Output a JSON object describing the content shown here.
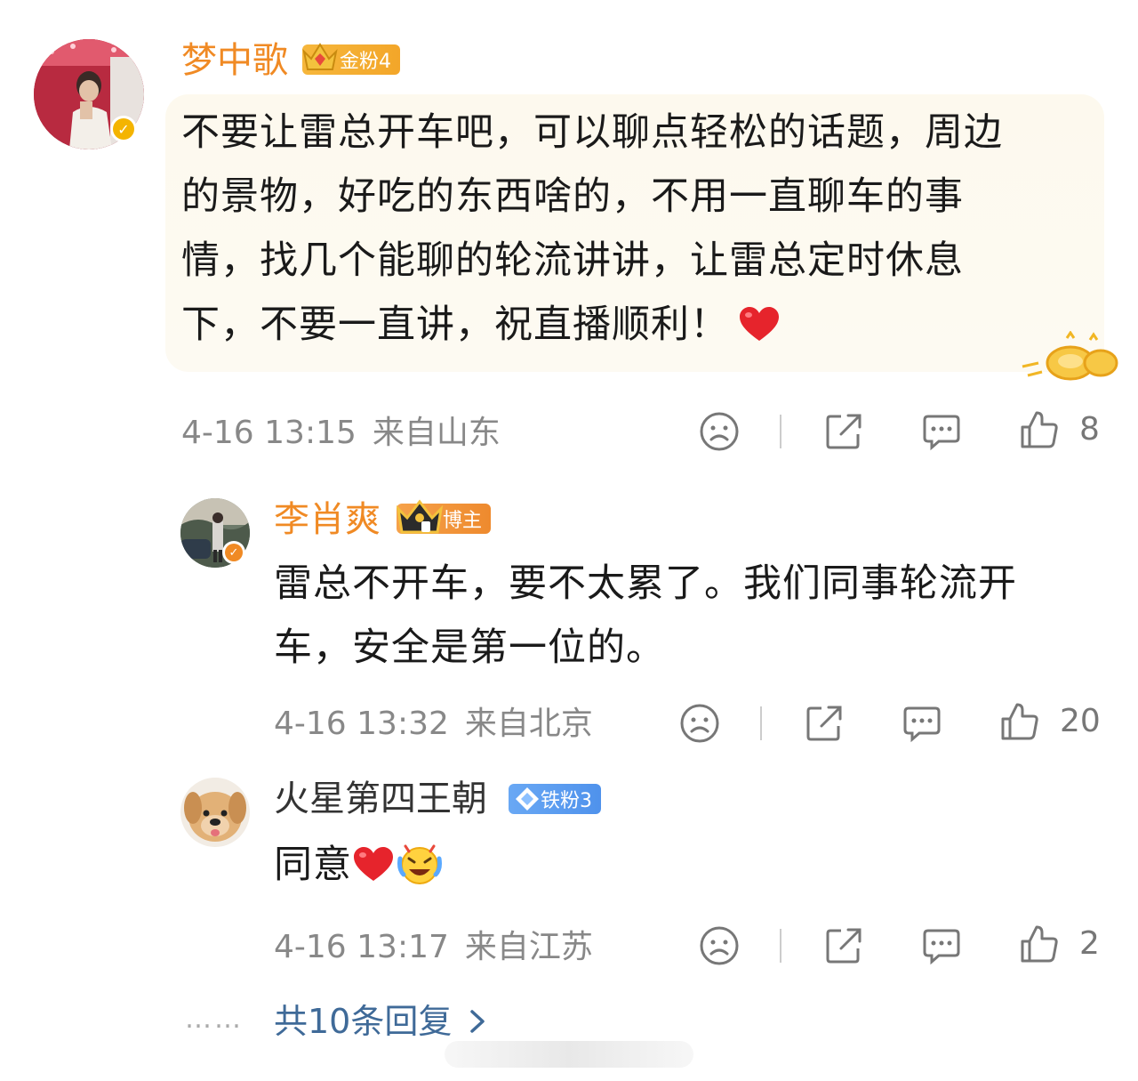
{
  "comment": {
    "author": "梦中歌",
    "badge": "金粉4",
    "text": "不要让雷总开车吧，可以聊点轻松的话题，周边的景物，好吃的东西啥的，不用一直聊车的事情，找几个能聊的轮流讲讲，让雷总定时休息下，不要一直讲，祝直播顺利！",
    "lines": [
      "不要让雷总开车吧，可以聊点轻松的话题，周边",
      "的景物，好吃的东西啥的，不用一直聊车的事",
      "情，找几个能聊的轮流讲讲，让雷总定时休息",
      "下，不要一直讲，祝直播顺利！"
    ],
    "time": "4-16 13:15",
    "location": "来自山东",
    "likes": "8"
  },
  "replies": [
    {
      "author": "李肖爽",
      "badge": "博主",
      "lines": [
        "雷总不开车，要不太累了。我们同事轮流开",
        "车，安全是第一位的。"
      ],
      "time": "4-16 13:32",
      "location": "来自北京",
      "likes": "20"
    },
    {
      "author": "火星第四王朝",
      "badge": "铁粉3",
      "text": "同意",
      "time": "4-16 13:17",
      "location": "来自江苏",
      "likes": "2"
    }
  ],
  "more_replies": "共10条回复",
  "dots": "……",
  "icons": {
    "dislike": "sad-face-icon",
    "share": "share-icon",
    "reply": "comment-icon",
    "like": "thumbs-up-icon"
  },
  "colors": {
    "name_orange": "#f08a24",
    "link_blue": "#3f6a98",
    "bubble_bg": "#fdf9ee"
  }
}
